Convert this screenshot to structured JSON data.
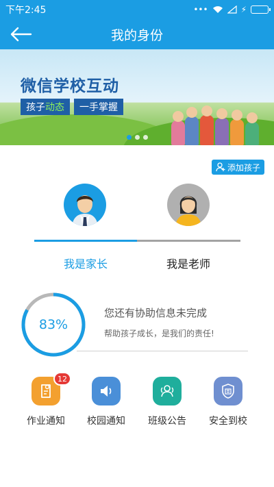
{
  "status_bar": {
    "time": "下午2:45"
  },
  "header": {
    "title": "我的身份"
  },
  "banner": {
    "title": "微信学校互动",
    "tag1_prefix": "孩子",
    "tag1_highlight": "动态",
    "tag2": "一手掌握"
  },
  "add_child": {
    "label": "添加孩子"
  },
  "roles": [
    {
      "label": "我是家长",
      "selected": true
    },
    {
      "label": "我是老师",
      "selected": false
    }
  ],
  "progress": {
    "value_text": "83%",
    "value": 0.83,
    "title": "您还有协助信息未完成",
    "subtitle": "帮助孩子成长，是我们的责任!"
  },
  "functions": [
    {
      "label": "作业通知",
      "badge": "12",
      "color": "#f3a02f",
      "icon": "homework-icon"
    },
    {
      "label": "校园通知",
      "color": "#4a8fd8",
      "icon": "speaker-icon"
    },
    {
      "label": "班级公告",
      "color": "#1fae9c",
      "icon": "class-icon"
    },
    {
      "label": "安全到校",
      "color": "#6f8fd0",
      "icon": "shield-icon"
    }
  ],
  "colors": {
    "primary": "#1b9de3"
  }
}
